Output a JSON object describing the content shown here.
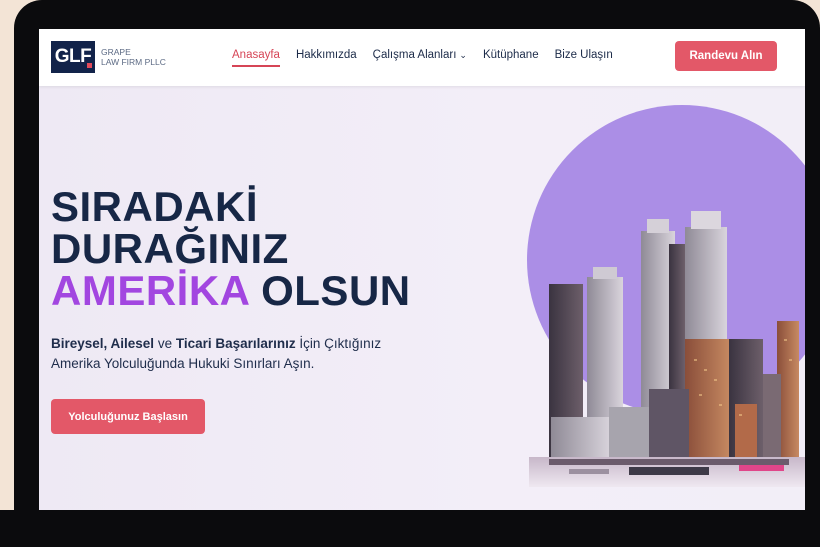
{
  "logo": {
    "mark": "GLF",
    "line1": "GRAPE",
    "line2": "LAW FIRM PLLC"
  },
  "nav": {
    "items": [
      {
        "label": "Anasayfa",
        "active": true
      },
      {
        "label": "Hakkımızda",
        "active": false
      },
      {
        "label": "Çalışma Alanları",
        "active": false,
        "dropdown": true
      },
      {
        "label": "Kütüphane",
        "active": false
      },
      {
        "label": "Bize Ulaşın",
        "active": false
      }
    ],
    "cta": "Randevu Alın"
  },
  "hero": {
    "headline_line1": "SIRADAKİ",
    "headline_line2": "DURAĞINIZ",
    "headline_line3_highlight": "AMERİKA",
    "headline_line3_rest": "OLSUN",
    "sub_bold1": "Bireysel, Ailesel",
    "sub_text1": " ve ",
    "sub_bold2": "Ticari Başarılarınız",
    "sub_text2": " İçin Çıktığınız",
    "sub_line2": "Amerika Yolculuğunda Hukuki Sınırları Aşın.",
    "cta": "Yolculuğunuz Başlasın"
  },
  "colors": {
    "accent": "#e35868",
    "brand_navy": "#12234a",
    "highlight_purple": "#a246e0",
    "circle_purple": "#ab8ee6",
    "device_bezel": "#0b0b0d"
  },
  "icons": {
    "dropdown": "chevron-down-icon",
    "skyline": "city-skyline-image"
  }
}
